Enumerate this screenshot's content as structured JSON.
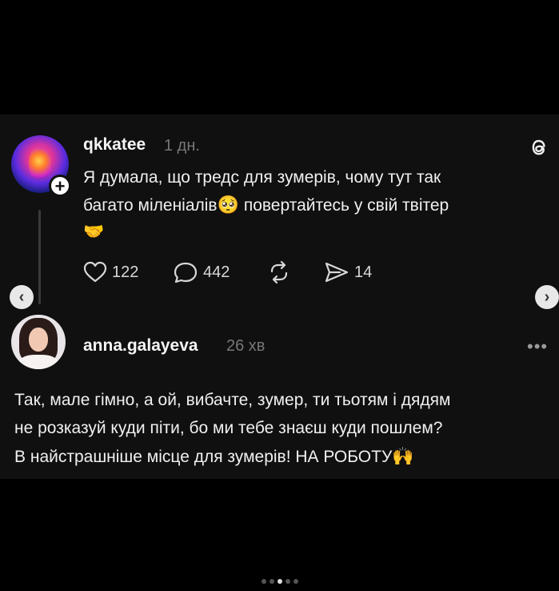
{
  "post1": {
    "username": "qkkatee",
    "time": "1 дн.",
    "line1": "Я думала, що тредс для зумерів, чому тут так",
    "line2a": "багато міленіалів",
    "emoji_pleading": "🥺",
    "line2b": " повертайтесь у свій твітер",
    "emoji_handshake": "🤝",
    "likes": "122",
    "replies": "442",
    "shares": "14"
  },
  "post2": {
    "username": "anna.galayeva",
    "time": "26 хв",
    "line1": "Так, мале гімно, а ой, вибачте, зумер, ти тьотям і дядям",
    "line2": "не розказуй куди піти, бо ми тебе знаєш куди пошлем?",
    "line3": "В найстрашніше місце для зумерів! НА РОБОТУ",
    "emoji_hands": "🙌",
    "more": "•••"
  },
  "nav": {
    "prev": "‹",
    "next": "›"
  },
  "carousel": {
    "count": 5,
    "active_index": 2
  },
  "icons": [
    "heart-icon",
    "comment-icon",
    "repost-icon",
    "send-icon",
    "threads-logo-icon",
    "more-icon"
  ]
}
